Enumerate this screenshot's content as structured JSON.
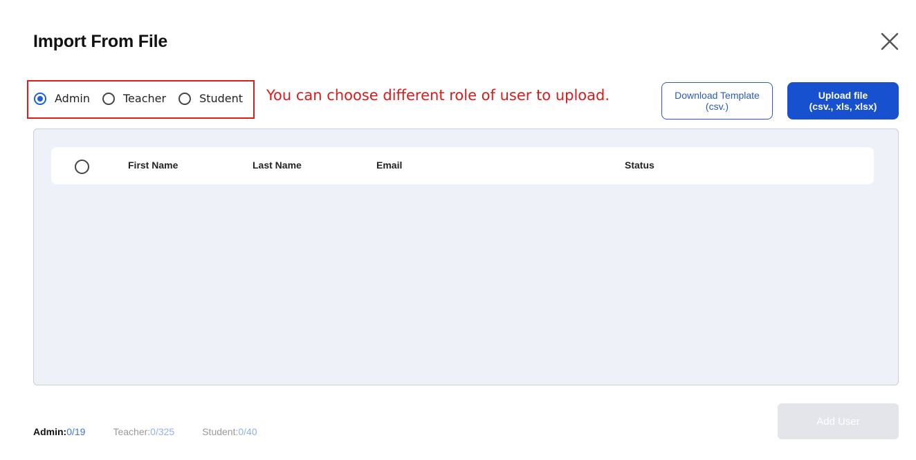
{
  "dialog": {
    "title": "Import From File"
  },
  "roles": {
    "options": [
      {
        "label": "Admin",
        "checked": true
      },
      {
        "label": "Teacher",
        "checked": false
      },
      {
        "label": "Student",
        "checked": false
      }
    ]
  },
  "annotation": {
    "text": "You can choose different role of user to upload."
  },
  "buttons": {
    "download_line1": "Download Template",
    "download_line2": "(csv.)",
    "upload_line1": "Upload file",
    "upload_line2": "(csv., xls, xlsx)",
    "add_user": "Add User"
  },
  "table": {
    "columns": [
      "First Name",
      "Last Name",
      "Email",
      "Status"
    ],
    "rows": []
  },
  "counts": {
    "admin_label": "Admin:",
    "admin_value": "0/19",
    "teacher_label": "Teacher:",
    "teacher_value": "0/325",
    "student_label": "Student:",
    "student_value": "0/40"
  },
  "colors": {
    "accent": "#1751d0",
    "annotation": "#d81b1b",
    "panel": "#eff1f8"
  },
  "icons": {
    "close": "close-icon"
  }
}
